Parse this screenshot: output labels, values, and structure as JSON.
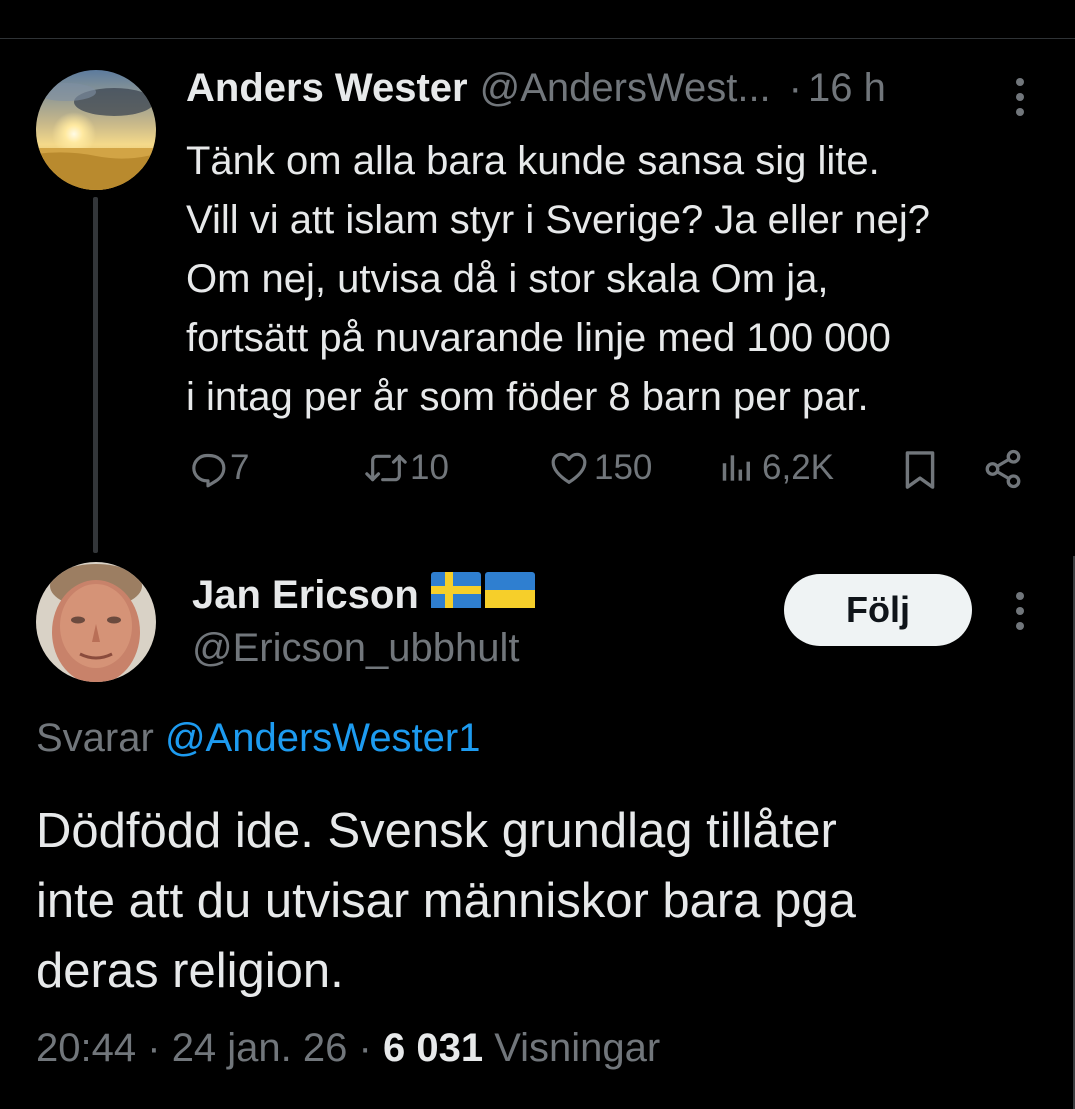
{
  "parent_tweet": {
    "author_name": "Anders Wester",
    "author_handle": "@AndersWest...",
    "separator": "·",
    "time": "16 h",
    "text": "Tänk om alla bara kunde sansa sig lite.\nVill vi att islam styr i Sverige? Ja eller nej?\nOm nej, utvisa då i stor skala Om ja,\nfortsätt på nuvarande linje med 100 000\ni intag per år som föder 8 barn per par.",
    "stats": {
      "replies": "7",
      "reposts": "10",
      "likes": "150",
      "views": "6,2K"
    },
    "icons": [
      "reply-icon",
      "repost-icon",
      "like-icon",
      "views-icon",
      "bookmark-icon",
      "share-icon",
      "more-icon"
    ]
  },
  "reply_tweet": {
    "author_name": "Jan Ericson",
    "author_flags": [
      "swedish-flag",
      "ukrainian-flag"
    ],
    "author_handle": "@Ericson_ubbhult",
    "follow_label": "Följ",
    "replying_label": "Svarar",
    "replying_to": "@AndersWester1",
    "text": "Dödfödd ide. Svensk grundlag tillåter\ninte att du utvisar människor bara pga\nderas religion.",
    "time": "20:44",
    "sep": "·",
    "date": "24 jan. 26",
    "views_count": "6 031",
    "views_label": "Visningar"
  },
  "colors": {
    "background": "#000000",
    "text_primary": "#e7e9ea",
    "text_secondary": "#71767b",
    "link": "#1d9bf0",
    "follow_button_bg": "#eff3f4",
    "divider": "#2f3336"
  }
}
